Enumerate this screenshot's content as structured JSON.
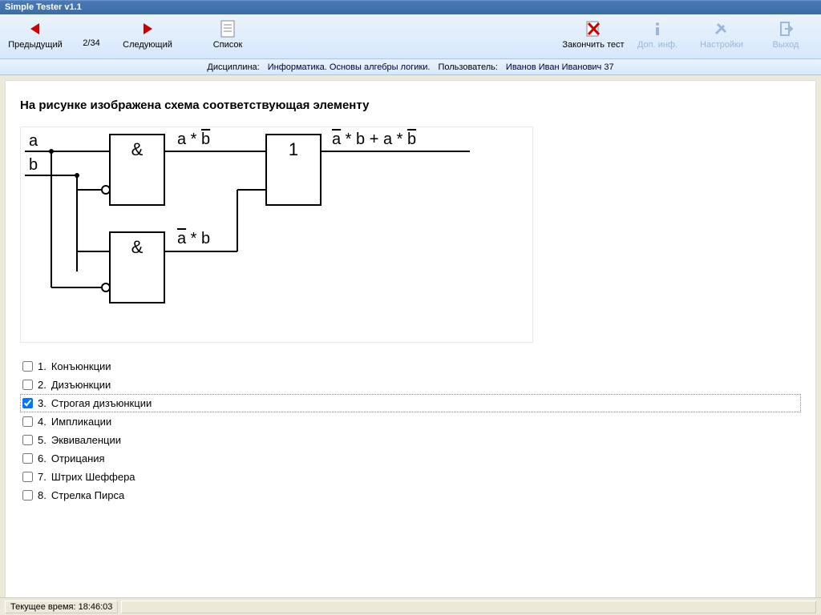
{
  "window": {
    "title": "Simple Tester v1.1"
  },
  "toolbar": {
    "prev": "Предыдущий",
    "counter": "2/34",
    "next": "Следующий",
    "list": "Список",
    "finish": "Закончить тест",
    "info": "Доп. инф.",
    "settings": "Настройки",
    "exit": "Выход"
  },
  "infobar": {
    "discipline_label": "Дисциплина:",
    "discipline": "Информатика. Основы алгебры логики.",
    "user_label": "Пользователь:",
    "user": "Иванов Иван Иванович  37"
  },
  "question": "На рисунке изображена схема соответствующая элементу",
  "diagram": {
    "input_a": "a",
    "input_b": "b",
    "gate_and": "&",
    "gate_or": "1",
    "mid1_a": "a * ",
    "mid1_b": "b",
    "mid2_a": "a",
    "mid2_b": " * b",
    "out_a": "a",
    "out_b": "b",
    "out_sep": " * ",
    "out_plus": " + a * "
  },
  "answers": [
    {
      "n": "1.",
      "label": "Конъюнкции",
      "checked": false
    },
    {
      "n": "2.",
      "label": "Дизъюнкции",
      "checked": false
    },
    {
      "n": "3.",
      "label": "Строгая дизъюнкции",
      "checked": true
    },
    {
      "n": "4.",
      "label": "Импликации",
      "checked": false
    },
    {
      "n": "5.",
      "label": "Эквиваленции",
      "checked": false
    },
    {
      "n": "6.",
      "label": "Отрицания",
      "checked": false
    },
    {
      "n": "7.",
      "label": "Штрих Шеффера",
      "checked": false
    },
    {
      "n": "8.",
      "label": "Стрелка Пирса",
      "checked": false
    }
  ],
  "status": {
    "time_label": "Текущее время:",
    "time": "18:46:03"
  }
}
